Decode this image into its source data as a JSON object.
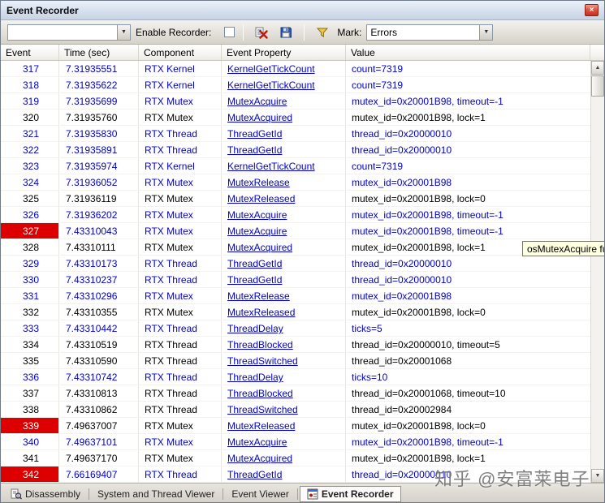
{
  "window": {
    "title": "Event Recorder",
    "close_glyph": "×"
  },
  "icons": {
    "dropdown_arrow": "▼",
    "scroll_up": "▲",
    "scroll_down": "▼",
    "clear": "clear-recorder-icon",
    "save": "save-record-icon",
    "filter": "filter-funnel-icon"
  },
  "toolbar": {
    "filter_combo_value": "",
    "enable_label": "Enable Recorder:",
    "enable_checked": false,
    "mark_label": "Mark:",
    "mark_value": "Errors"
  },
  "table": {
    "columns": [
      "Event",
      "Time (sec)",
      "Component",
      "Event Property",
      "Value"
    ],
    "rows": [
      {
        "event": "317",
        "time": "7.31935551",
        "component": "RTX Kernel",
        "property": "KernelGetTickCount",
        "value": "count=7319",
        "kind": "call",
        "marked": false
      },
      {
        "event": "318",
        "time": "7.31935622",
        "component": "RTX Kernel",
        "property": "KernelGetTickCount",
        "value": "count=7319",
        "kind": "call",
        "marked": false
      },
      {
        "event": "319",
        "time": "7.31935699",
        "component": "RTX Mutex",
        "property": "MutexAcquire",
        "value": "mutex_id=0x20001B98, timeout=-1",
        "kind": "call",
        "marked": false
      },
      {
        "event": "320",
        "time": "7.31935760",
        "component": "RTX Mutex",
        "property": "MutexAcquired",
        "value": "mutex_id=0x20001B98, lock=1",
        "kind": "status",
        "marked": false
      },
      {
        "event": "321",
        "time": "7.31935830",
        "component": "RTX Thread",
        "property": "ThreadGetId",
        "value": "thread_id=0x20000010",
        "kind": "call",
        "marked": false
      },
      {
        "event": "322",
        "time": "7.31935891",
        "component": "RTX Thread",
        "property": "ThreadGetId",
        "value": "thread_id=0x20000010",
        "kind": "call",
        "marked": false
      },
      {
        "event": "323",
        "time": "7.31935974",
        "component": "RTX Kernel",
        "property": "KernelGetTickCount",
        "value": "count=7319",
        "kind": "call",
        "marked": false
      },
      {
        "event": "324",
        "time": "7.31936052",
        "component": "RTX Mutex",
        "property": "MutexRelease",
        "value": "mutex_id=0x20001B98",
        "kind": "call",
        "marked": false
      },
      {
        "event": "325",
        "time": "7.31936119",
        "component": "RTX Mutex",
        "property": "MutexReleased",
        "value": "mutex_id=0x20001B98, lock=0",
        "kind": "status",
        "marked": false
      },
      {
        "event": "326",
        "time": "7.31936202",
        "component": "RTX Mutex",
        "property": "MutexAcquire",
        "value": "mutex_id=0x20001B98, timeout=-1",
        "kind": "call",
        "marked": false
      },
      {
        "event": "327",
        "time": "7.43310043",
        "component": "RTX Mutex",
        "property": "MutexAcquire",
        "value": "mutex_id=0x20001B98, timeout=-1",
        "kind": "call",
        "marked": true
      },
      {
        "event": "328",
        "time": "7.43310111",
        "component": "RTX Mutex",
        "property": "MutexAcquired",
        "value": "mutex_id=0x20001B98, lock=1",
        "kind": "status",
        "marked": false
      },
      {
        "event": "329",
        "time": "7.43310173",
        "component": "RTX Thread",
        "property": "ThreadGetId",
        "value": "thread_id=0x20000010",
        "kind": "call",
        "marked": false
      },
      {
        "event": "330",
        "time": "7.43310237",
        "component": "RTX Thread",
        "property": "ThreadGetId",
        "value": "thread_id=0x20000010",
        "kind": "call",
        "marked": false
      },
      {
        "event": "331",
        "time": "7.43310296",
        "component": "RTX Mutex",
        "property": "MutexRelease",
        "value": "mutex_id=0x20001B98",
        "kind": "call",
        "marked": false
      },
      {
        "event": "332",
        "time": "7.43310355",
        "component": "RTX Mutex",
        "property": "MutexReleased",
        "value": "mutex_id=0x20001B98, lock=0",
        "kind": "status",
        "marked": false
      },
      {
        "event": "333",
        "time": "7.43310442",
        "component": "RTX Thread",
        "property": "ThreadDelay",
        "value": "ticks=5",
        "kind": "call",
        "marked": false
      },
      {
        "event": "334",
        "time": "7.43310519",
        "component": "RTX Thread",
        "property": "ThreadBlocked",
        "value": "thread_id=0x20000010, timeout=5",
        "kind": "status",
        "marked": false
      },
      {
        "event": "335",
        "time": "7.43310590",
        "component": "RTX Thread",
        "property": "ThreadSwitched",
        "value": "thread_id=0x20001068",
        "kind": "status",
        "marked": false
      },
      {
        "event": "336",
        "time": "7.43310742",
        "component": "RTX Thread",
        "property": "ThreadDelay",
        "value": "ticks=10",
        "kind": "call",
        "marked": false
      },
      {
        "event": "337",
        "time": "7.43310813",
        "component": "RTX Thread",
        "property": "ThreadBlocked",
        "value": "thread_id=0x20001068, timeout=10",
        "kind": "status",
        "marked": false
      },
      {
        "event": "338",
        "time": "7.43310862",
        "component": "RTX Thread",
        "property": "ThreadSwitched",
        "value": "thread_id=0x20002984",
        "kind": "status",
        "marked": false
      },
      {
        "event": "339",
        "time": "7.49637007",
        "component": "RTX Mutex",
        "property": "MutexReleased",
        "value": "mutex_id=0x20001B98, lock=0",
        "kind": "status",
        "marked": true
      },
      {
        "event": "340",
        "time": "7.49637101",
        "component": "RTX Mutex",
        "property": "MutexAcquire",
        "value": "mutex_id=0x20001B98, timeout=-1",
        "kind": "call",
        "marked": false
      },
      {
        "event": "341",
        "time": "7.49637170",
        "component": "RTX Mutex",
        "property": "MutexAcquired",
        "value": "mutex_id=0x20001B98, lock=1",
        "kind": "status",
        "marked": false
      },
      {
        "event": "342",
        "time": "7.66169407",
        "component": "RTX Thread",
        "property": "ThreadGetId",
        "value": "thread_id=0x20000010",
        "kind": "call",
        "marked": true
      }
    ]
  },
  "tooltip": {
    "text": "osMutexAcquire fu"
  },
  "tabbar": {
    "tabs": [
      {
        "label": "Disassembly"
      },
      {
        "label": "System and Thread Viewer"
      },
      {
        "label": "Event Viewer"
      },
      {
        "label": "Event Recorder"
      }
    ]
  },
  "watermark": "知乎 @安富莱电子",
  "colors": {
    "call_event_text": "#0000cc",
    "status_event_text": "#000000",
    "link": "#0000cc",
    "mark_background": "#dd0000",
    "tooltip_background": "#ffffe1"
  }
}
